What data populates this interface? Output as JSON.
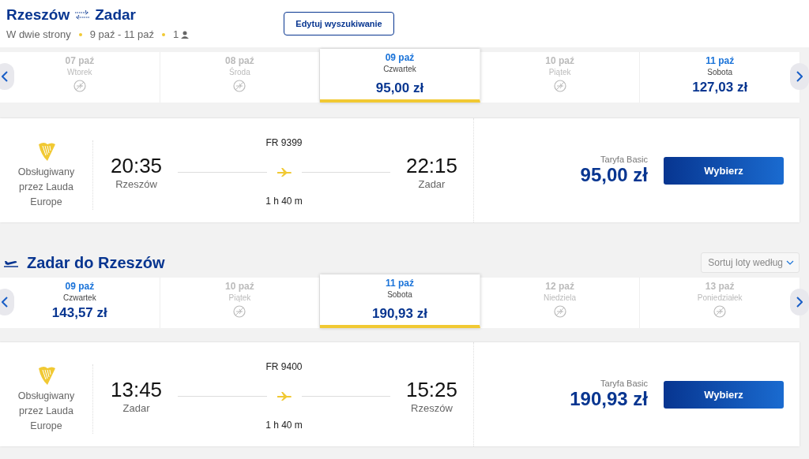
{
  "header": {
    "origin": "Rzeszów",
    "destination": "Zadar",
    "trip_type": "W dwie strony",
    "dates": "9 paź - 11 paź",
    "passengers": "1",
    "edit_button": "Edytuj wyszukiwanie"
  },
  "sections": [
    {
      "days": [
        {
          "date": "07 paź",
          "weekday": "Wtorek",
          "selected": false
        },
        {
          "date": "08 paź",
          "weekday": "Środa",
          "selected": false
        },
        {
          "date": "09 paź",
          "weekday": "Czwartek",
          "price": "95,00 zł",
          "selected": true
        },
        {
          "date": "10 paź",
          "weekday": "Piątek",
          "selected": false
        },
        {
          "date": "11 paź",
          "weekday": "Sobota",
          "price": "127,03 zł",
          "selected": false
        }
      ],
      "flight": {
        "operator": "Obsługiwany przez Lauda Europe",
        "number": "FR 9399",
        "depart_time": "20:35",
        "depart_city": "Rzeszów",
        "arrive_time": "22:15",
        "arrive_city": "Zadar",
        "duration": "1 h 40 m",
        "fare": "Taryfa Basic",
        "price": "95,00 zł",
        "button": "Wybierz"
      }
    },
    {
      "title": "Zadar do Rzeszów",
      "sort_label": "Sortuj loty według",
      "days": [
        {
          "date": "09 paź",
          "weekday": "Czwartek",
          "price": "143,57 zł",
          "selected": false
        },
        {
          "date": "10 paź",
          "weekday": "Piątek",
          "selected": false
        },
        {
          "date": "11 paź",
          "weekday": "Sobota",
          "price": "190,93 zł",
          "selected": true
        },
        {
          "date": "12 paź",
          "weekday": "Niedziela",
          "selected": false
        },
        {
          "date": "13 paź",
          "weekday": "Poniedziałek",
          "selected": false
        }
      ],
      "flight": {
        "operator": "Obsługiwany przez Lauda Europe",
        "number": "FR 9400",
        "depart_time": "13:45",
        "depart_city": "Zadar",
        "arrive_time": "15:25",
        "arrive_city": "Rzeszów",
        "duration": "1 h 40 m",
        "fare": "Taryfa Basic",
        "price": "190,93 zł",
        "button": "Wybierz"
      }
    }
  ]
}
